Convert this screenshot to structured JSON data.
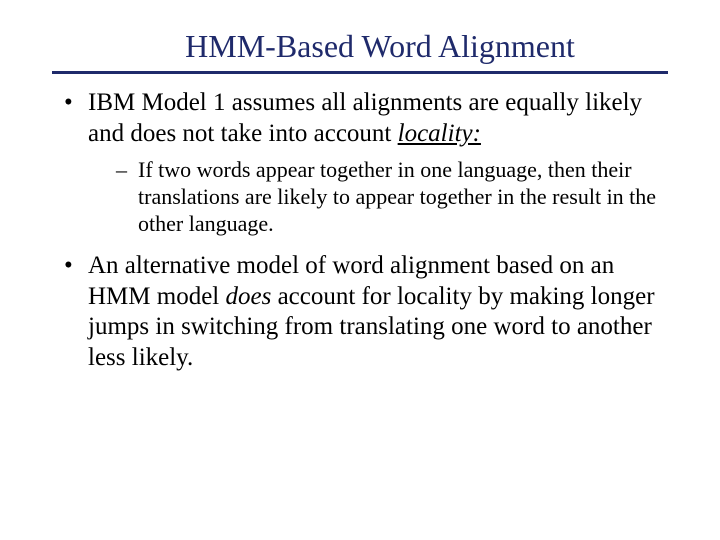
{
  "title": "HMM-Based Word Alignment",
  "bullets": {
    "b1_pre": "IBM Model 1 assumes all alignments are equally likely and does not take into account ",
    "b1_em": "locality:",
    "b1_sub1": "If two words appear together in one language, then their translations are likely to appear together in the result in the other language.",
    "b2_pre": "An alternative model of word alignment based on an HMM model ",
    "b2_em": "does",
    "b2_post": " account for locality by making longer jumps in switching from translating one word to another less likely."
  }
}
